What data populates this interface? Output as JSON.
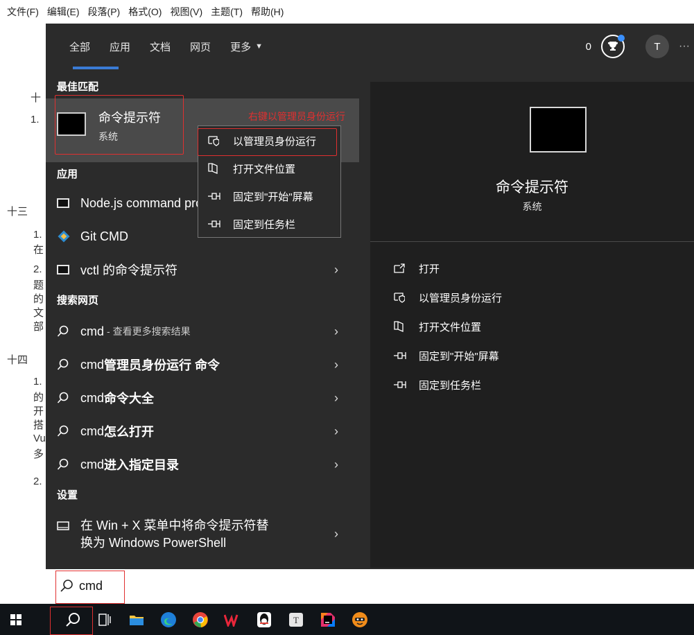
{
  "menubar": [
    "文件(F)",
    "编辑(E)",
    "段落(P)",
    "格式(O)",
    "视图(V)",
    "主题(T)",
    "帮助(H)"
  ],
  "bg_doc": [
    "十",
    "1.",
    "十三",
    "1.",
    "在",
    "2.",
    "题",
    "的",
    "文",
    "部",
    "十四",
    "1.",
    "的",
    "开",
    "搭",
    "Vu",
    "多",
    "2."
  ],
  "tabs": {
    "all": "全部",
    "apps": "应用",
    "docs": "文档",
    "web": "网页",
    "more": "更多"
  },
  "header": {
    "count": "0",
    "avatar": "T",
    "more": "···"
  },
  "sections": {
    "best": "最佳匹配",
    "apps": "应用",
    "web": "搜索网页",
    "settings": "设置"
  },
  "best": {
    "title": "命令提示符",
    "sub": "系统"
  },
  "annotation": "右键以管理员身份运行",
  "context_menu": [
    "以管理员身份运行",
    "打开文件位置",
    "固定到\"开始\"屏幕",
    "固定到任务栏"
  ],
  "apps": [
    "Node.js command prompt",
    "Git CMD",
    "vctl 的命令提示符"
  ],
  "web": [
    {
      "prefix": "cmd",
      "rest": "- 查看更多搜索结果"
    },
    {
      "prefix": "cmd",
      "rest": "管理员身份运行 命令"
    },
    {
      "prefix": "cmd",
      "rest": "命令大全"
    },
    {
      "prefix": "cmd",
      "rest": "怎么打开"
    },
    {
      "prefix": "cmd",
      "rest": "进入指定目录"
    }
  ],
  "settings_item": {
    "line1": "在 Win + X 菜单中将命令提示符替",
    "line2": "换为 Windows PowerShell"
  },
  "preview": {
    "title": "命令提示符",
    "sub": "系统"
  },
  "actions": [
    "打开",
    "以管理员身份运行",
    "打开文件位置",
    "固定到\"开始\"屏幕",
    "固定到任务栏"
  ],
  "search": {
    "value": "cmd"
  },
  "colors": {
    "accent": "#3a7bd5",
    "annotation": "#e03030",
    "panel": "#2b2b2b"
  }
}
